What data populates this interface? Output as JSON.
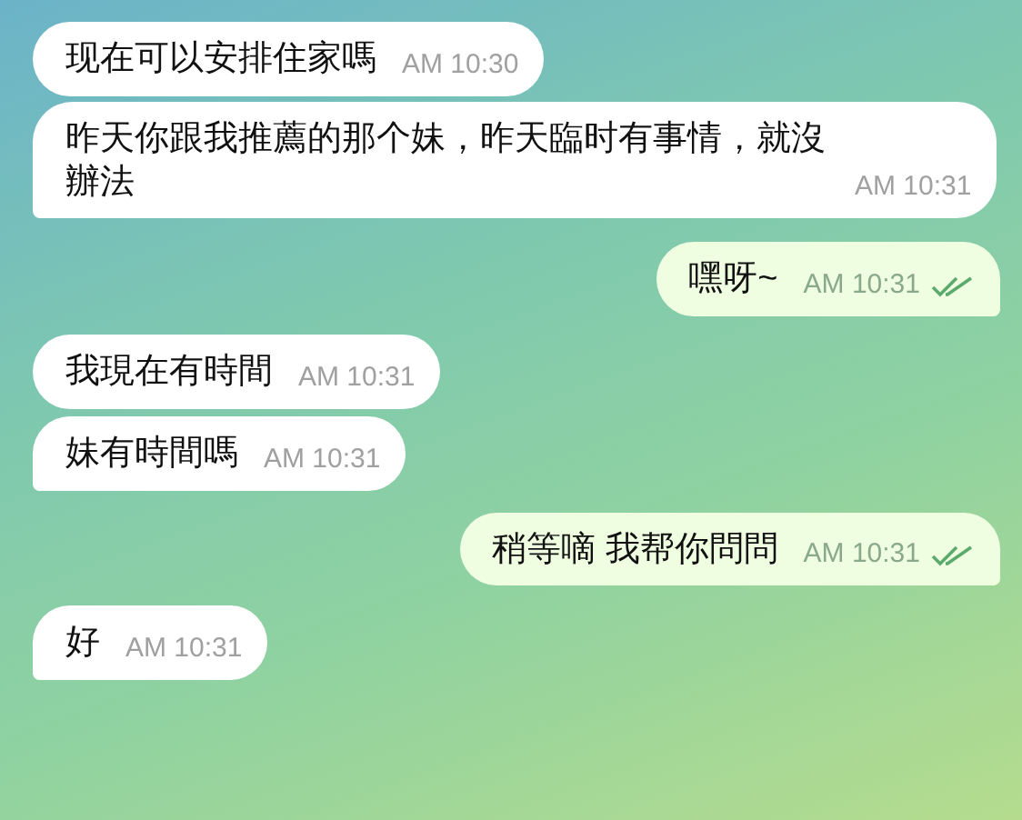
{
  "messages": [
    {
      "kind": "incoming",
      "text": "现在可以安排住家嗎",
      "time": "AM 10:30",
      "tail": false
    },
    {
      "kind": "incoming",
      "text": "昨天你跟我推薦的那个妹，昨天臨时有事情，就沒辦法",
      "time": "AM 10:31",
      "tail": true
    },
    {
      "kind": "outgoing",
      "text": "嘿呀~",
      "time": "AM 10:31",
      "tail": true,
      "read": true
    },
    {
      "kind": "incoming",
      "text": "我現在有時間",
      "time": "AM 10:31",
      "tail": false
    },
    {
      "kind": "incoming",
      "text": "妹有時間嗎",
      "time": "AM 10:31",
      "tail": true
    },
    {
      "kind": "outgoing",
      "text": "稍等嘀 我帮你問問",
      "time": "AM 10:31",
      "tail": true,
      "read": true
    },
    {
      "kind": "incoming",
      "text": "好",
      "time": "AM 10:31",
      "tail": true
    }
  ]
}
